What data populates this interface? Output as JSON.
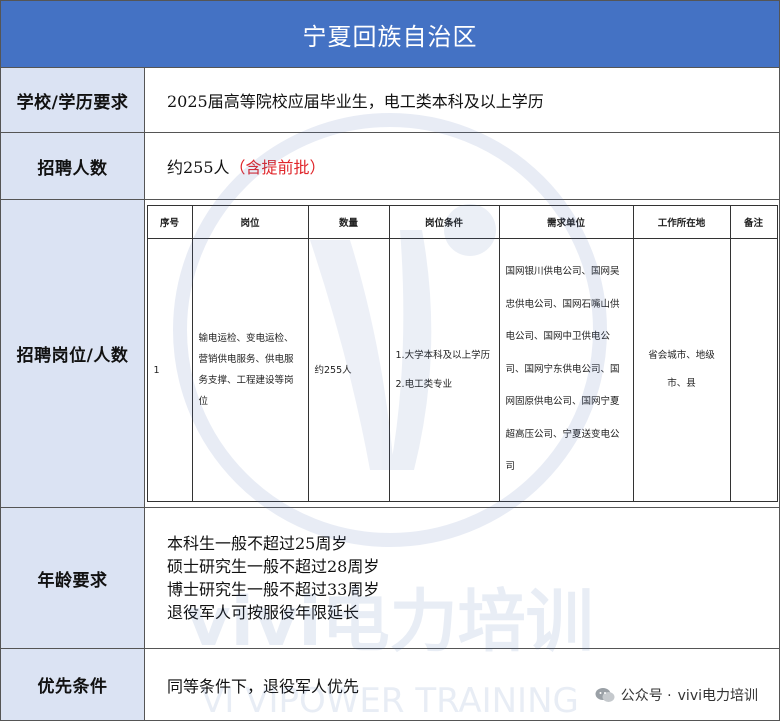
{
  "title": "宁夏回族自治区",
  "rows": {
    "school": {
      "label": "学校/学历要求",
      "value": "2025届高等院校应届毕业生，电工类本科及以上学历"
    },
    "count": {
      "label": "招聘人数",
      "value": "约255人",
      "note": "（含提前批）"
    },
    "positions": {
      "label": "招聘岗位/人数",
      "headers": [
        "序号",
        "岗位",
        "数量",
        "岗位条件",
        "需求单位",
        "工作所在地",
        "备注"
      ],
      "row": {
        "no": "1",
        "post": "输电运检、变电运检、营销供电服务、供电服务支撑、工程建设等岗位",
        "qty": "约255人",
        "cond1": "1.大学本科及以上学历",
        "cond2": "2.电工类专业",
        "units": "国网银川供电公司、国网吴忠供电公司、国网石嘴山供电公司、国网中卫供电公司、国网宁东供电公司、国网固原供电公司、国网宁夏超高压公司、宁夏送变电公司",
        "location": "省会城市、地级市、县",
        "remark": ""
      }
    },
    "age": {
      "label": "年龄要求",
      "lines": [
        "本科生一般不超过25周岁",
        "硕士研究生一般不超过28周岁",
        "博士研究生一般不超过33周岁",
        "退役军人可按服役年限延长"
      ]
    },
    "priority": {
      "label": "优先条件",
      "value": "同等条件下，退役军人优先"
    }
  },
  "footer": {
    "prefix": "公众号 · ",
    "account": "vivi电力培训"
  },
  "watermark": {
    "text1": "vivi电力培训",
    "text2": "VI VIPOWER TRAINING"
  },
  "colors": {
    "header": "#4472c4",
    "label_bg": "#dbe3f3",
    "note": "#e0262b"
  }
}
